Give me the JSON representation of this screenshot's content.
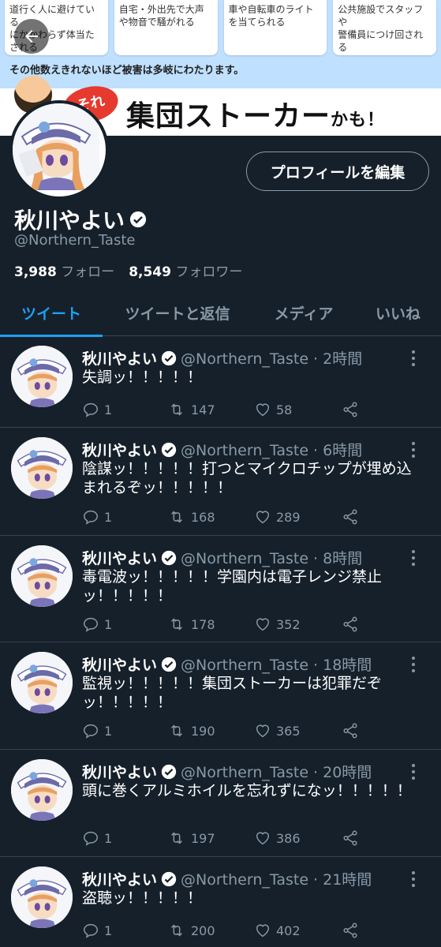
{
  "banner": {
    "cards": [
      "道行く人に避けている\nにかかわらず体当た\nされる",
      "自宅・外出先で大声\nや物音で騒がれる",
      "車や自転車のライト\nを当てられる",
      "公共施設でスタッフや\n警備員につけ回される"
    ],
    "note": "その他数えきれないほど被害は多岐にわたります。",
    "bubble": "それ",
    "title": "集団ストーカー",
    "title_suffix": "かも！"
  },
  "profile": {
    "edit_label": "プロフィールを編集",
    "name": "秋川やよい",
    "handle": "@Northern_Taste",
    "following_count": "3,988",
    "following_label": "フォロー",
    "followers_count": "8,549",
    "followers_label": "フォロワー"
  },
  "tabs": [
    {
      "label": "ツイート"
    },
    {
      "label": "ツイートと返信"
    },
    {
      "label": "メディア"
    },
    {
      "label": "いいね"
    }
  ],
  "colors": {
    "accent": "#1da1f2",
    "background": "#15202b",
    "muted": "#8899a6"
  },
  "tweets": [
    {
      "name": "秋川やよい",
      "meta": "@Northern_Taste · 2時間",
      "text": "失調ッ！！！！！",
      "replies": "1",
      "retweets": "147",
      "likes": "58"
    },
    {
      "name": "秋川やよい",
      "meta": "@Northern_Taste · 6時間",
      "text": "陰謀ッ！！！！！打つとマイクロチップが埋め込まれるぞッ！！！！！",
      "replies": "1",
      "retweets": "168",
      "likes": "289"
    },
    {
      "name": "秋川やよい",
      "meta": "@Northern_Taste · 8時間",
      "text": "毒電波ッ！！！！！学園内は電子レンジ禁止ッ！！！！！",
      "replies": "1",
      "retweets": "178",
      "likes": "352"
    },
    {
      "name": "秋川やよい",
      "meta": "@Northern_Taste · 18時間",
      "text": "監視ッ！！！！！集団ストーカーは犯罪だぞッ！！！！！",
      "replies": "1",
      "retweets": "190",
      "likes": "365"
    },
    {
      "name": "秋川やよい",
      "meta": "@Northern_Taste · 20時間",
      "text": "頭に巻くアルミホイルを忘れずになッ！！！！！",
      "replies": "1",
      "retweets": "197",
      "likes": "386"
    },
    {
      "name": "秋川やよい",
      "meta": "@Northern_Taste · 21時間",
      "text": "盗聴ッ！！！！！",
      "replies": "1",
      "retweets": "200",
      "likes": "402"
    }
  ]
}
